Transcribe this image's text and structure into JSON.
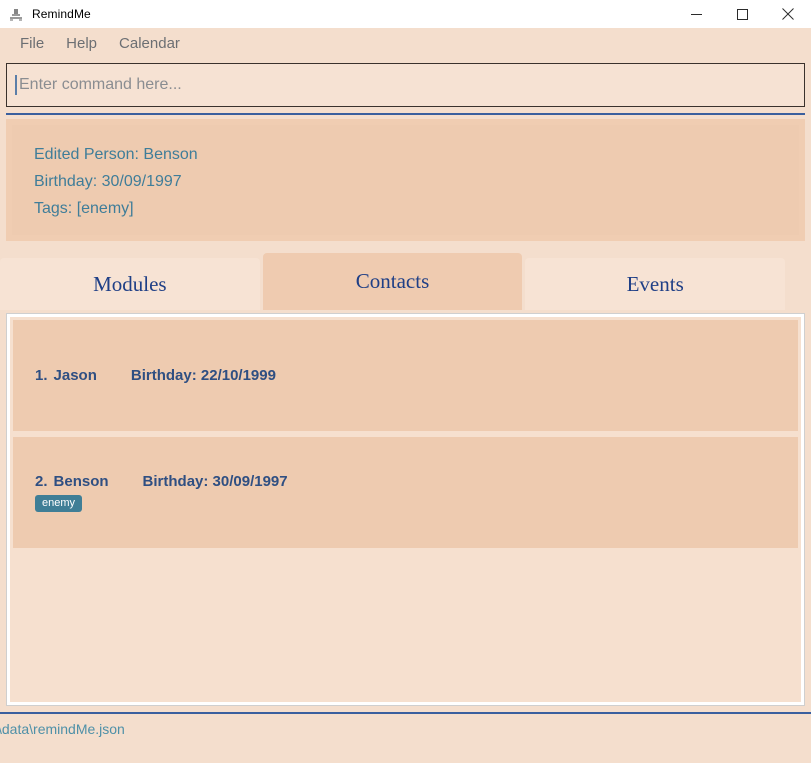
{
  "window": {
    "title": "RemindMe",
    "icon": "app-icon",
    "controls": {
      "minimize": "minimize-icon",
      "maximize": "maximize-icon",
      "close": "close-icon"
    }
  },
  "menu": {
    "items": [
      {
        "label": "File"
      },
      {
        "label": "Help"
      },
      {
        "label": "Calendar"
      }
    ]
  },
  "command": {
    "value": "",
    "placeholder": "Enter command here..."
  },
  "result": {
    "lines": [
      "Edited Person: Benson",
      "Birthday: 30/09/1997",
      "Tags: [enemy]"
    ]
  },
  "tabs": {
    "selected": "Contacts",
    "items": [
      {
        "label": "Modules",
        "selected": false
      },
      {
        "label": "Contacts",
        "selected": true
      },
      {
        "label": "Events",
        "selected": false
      }
    ]
  },
  "contacts": [
    {
      "index": "1.",
      "name": "Jason",
      "birthday": "Birthday: 22/10/1999",
      "tags": []
    },
    {
      "index": "2.",
      "name": "Benson",
      "birthday": "Birthday: 30/09/1997",
      "tags": [
        "enemy"
      ]
    }
  ],
  "status": {
    "path": "\\data\\remindMe.json"
  },
  "colors": {
    "window_background": "#f4decd",
    "panel": "#eecbb0",
    "tab_selected": "#efcbb0",
    "tab_unselected": "#f7e3d4",
    "accent_blue": "#3a5f9e",
    "text_blue": "#2f4f82",
    "result_text": "#3f7d99",
    "tag_badge": "#3f7e96",
    "titlebar": "#ffffff"
  }
}
